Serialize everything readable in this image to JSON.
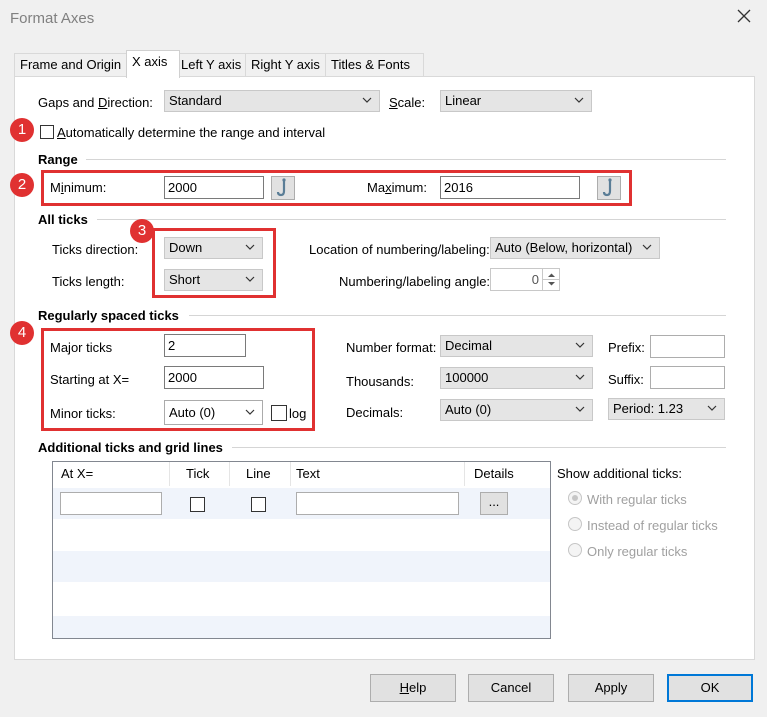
{
  "window": {
    "title": "Format Axes"
  },
  "tabs": [
    {
      "label": "Frame and Origin"
    },
    {
      "label": "X axis"
    },
    {
      "label": "Left Y axis"
    },
    {
      "label": "Right Y axis"
    },
    {
      "label": "Titles & Fonts"
    }
  ],
  "gaps": {
    "label_pre": "Gaps and ",
    "label_u": "D",
    "label_post": "irection:",
    "value": "Standard"
  },
  "scale": {
    "label_u": "S",
    "label_post": "cale:",
    "value": "Linear"
  },
  "auto_range": {
    "label_u": "A",
    "label_post": "utomatically determine the range and interval",
    "checked": false
  },
  "range": {
    "heading": "Range",
    "min_label_pre": "M",
    "min_label_u": "i",
    "min_label_post": "nimum:",
    "min_value": "2000",
    "max_label_pre": "Ma",
    "max_label_u": "x",
    "max_label_post": "imum:",
    "max_value": "2016"
  },
  "all_ticks": {
    "heading": "All ticks",
    "direction_label": "Ticks direction:",
    "direction_value": "Down",
    "length_label": "Ticks length:",
    "length_value": "Short",
    "location_label": "Location of numbering/labeling:",
    "location_value": "Auto (Below, horizontal)",
    "angle_label": "Numbering/labeling angle:",
    "angle_value": "0"
  },
  "regular": {
    "heading": "Regularly spaced ticks",
    "major_label": "Major ticks",
    "major_value": "2",
    "start_label": "Starting at X=",
    "start_value": "2000",
    "minor_label": "Minor ticks:",
    "minor_value": "Auto (0)",
    "log_label": "log",
    "numformat_label": "Number format:",
    "numformat_value": "Decimal",
    "thousands_label": "Thousands:",
    "thousands_value": "100000",
    "decimals_label": "Decimals:",
    "decimals_value": "Auto (0)",
    "prefix_label": "Prefix:",
    "suffix_label": "Suffix:",
    "period_value": "Period: 1.23"
  },
  "additional": {
    "heading": "Additional ticks and grid lines",
    "columns": [
      "At X=",
      "Tick",
      "Line",
      "Text",
      "Details"
    ],
    "details_button": "...",
    "show_label": "Show additional ticks:",
    "options": [
      "With regular ticks",
      "Instead of regular ticks",
      "Only regular ticks"
    ],
    "selected": 0
  },
  "badges": [
    "1",
    "2",
    "3",
    "4"
  ],
  "buttons": {
    "help_u": "H",
    "help_post": "elp",
    "cancel": "Cancel",
    "apply": "Apply",
    "ok": "OK"
  },
  "colors": {
    "highlight": "#e03131",
    "panel": "#ffffff",
    "dialog": "#f0f0f0"
  }
}
